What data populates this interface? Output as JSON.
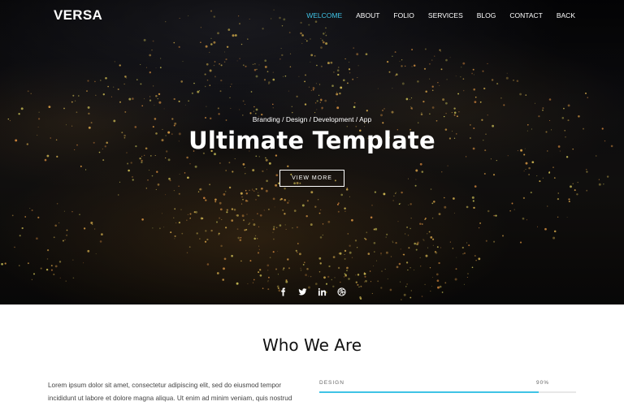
{
  "brand": "VERSA",
  "nav": {
    "items": [
      {
        "label": "WELCOME",
        "active": true
      },
      {
        "label": "ABOUT",
        "active": false
      },
      {
        "label": "FOLIO",
        "active": false
      },
      {
        "label": "SERVICES",
        "active": false
      },
      {
        "label": "BLOG",
        "active": false
      },
      {
        "label": "CONTACT",
        "active": false
      },
      {
        "label": "BACK",
        "active": false
      }
    ]
  },
  "hero": {
    "eyebrow": "Branding / Design / Development / App",
    "title": "Ultimate Template",
    "button_label": "VIEW MORE"
  },
  "socials": [
    "facebook-icon",
    "twitter-icon",
    "linkedin-icon",
    "dribbble-icon"
  ],
  "about": {
    "title": "Who We Are",
    "text": "Lorem ipsum dolor sit amet, consectetur adipiscing elit, sed do eiusmod tempor incididunt ut labore et dolore magna aliqua. Ut enim ad minim veniam, quis nostrud",
    "skill": {
      "label": "DESIGN",
      "percent_label": "90%",
      "value": 0.9
    }
  },
  "colors": {
    "accent": "#3fc3e6",
    "hero_bg": "#0b0a09",
    "text_dark": "#111111"
  }
}
